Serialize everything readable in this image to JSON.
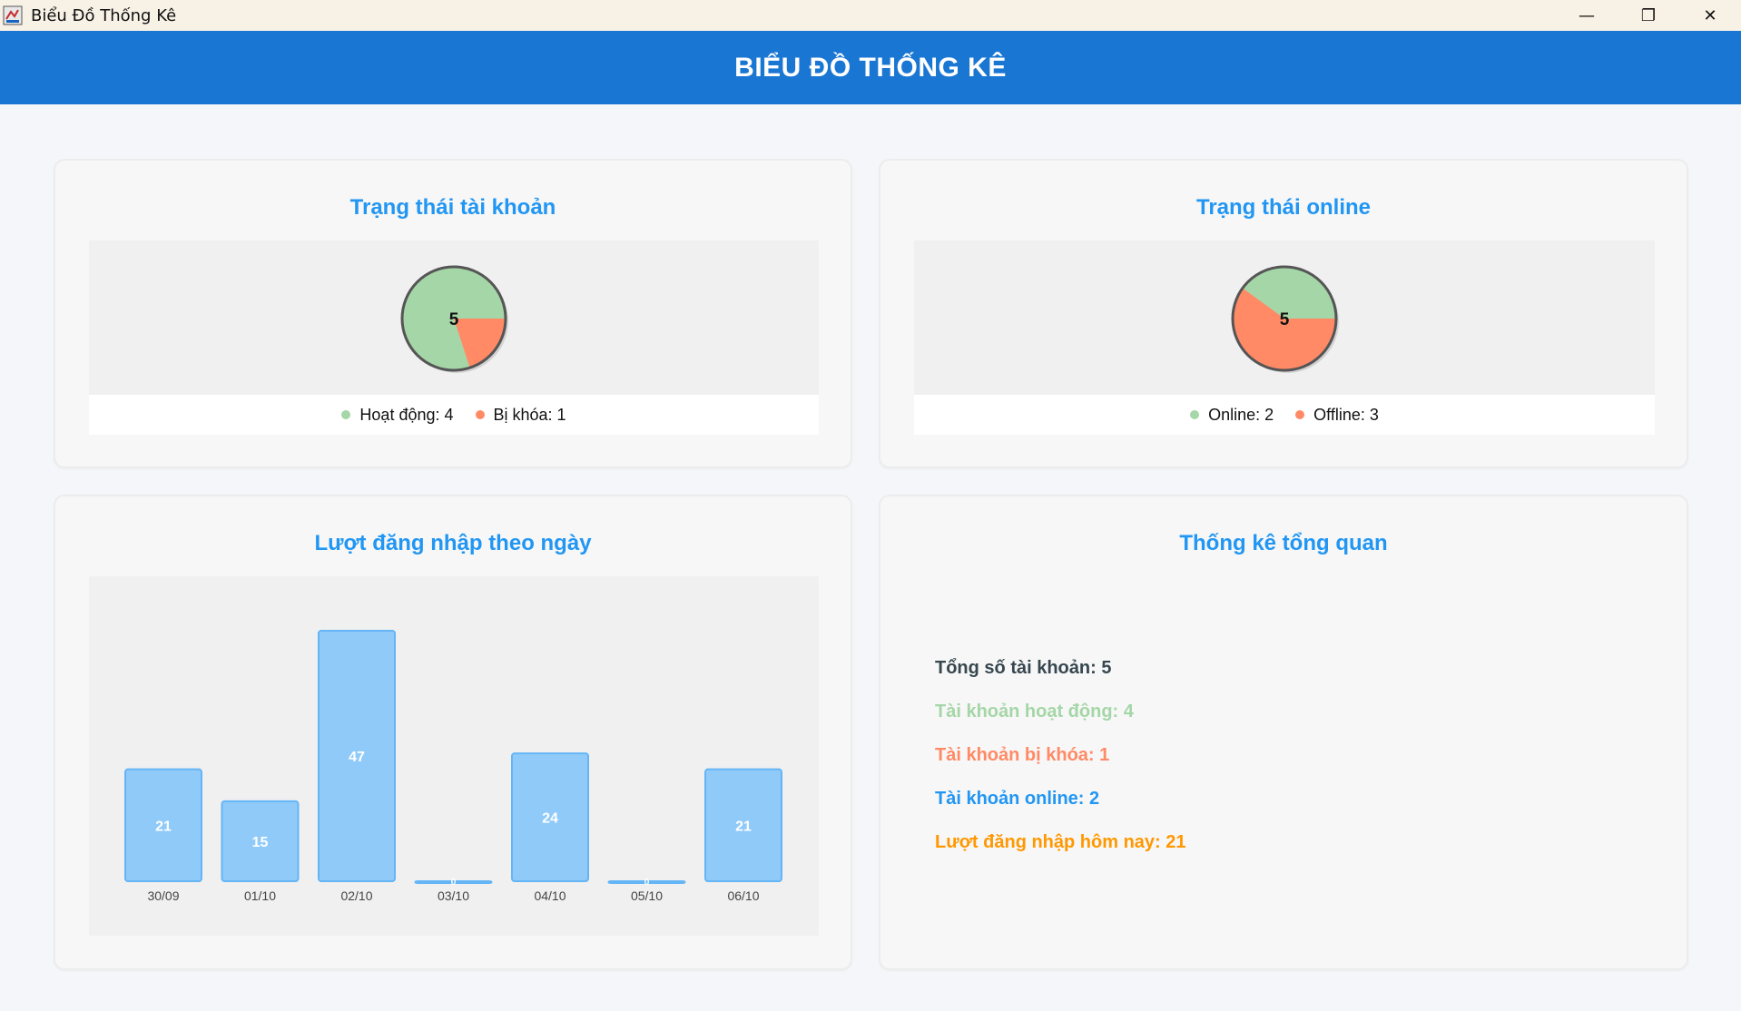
{
  "window": {
    "title": "Biểu Đồ Thống Kê",
    "controls": {
      "minimize": "—",
      "restore": "❐",
      "close": "✕"
    }
  },
  "header": {
    "title": "BIỂU ĐỒ THỐNG KÊ",
    "color": "#1976d2"
  },
  "colors": {
    "accent": "#2196f3",
    "green": "#a5d6a7",
    "orange": "#ff8a65",
    "bar": "#90caf9",
    "bar_border": "#64b5f6",
    "amber": "#ff9800",
    "dark": "#37474f"
  },
  "account_status": {
    "title": "Trạng thái tài khoản",
    "total_label": "5",
    "legend": [
      {
        "label": "Hoạt động: 4",
        "color": "#a5d6a7"
      },
      {
        "label": "Bị khóa: 1",
        "color": "#ff8a65"
      }
    ]
  },
  "online_status": {
    "title": "Trạng thái online",
    "total_label": "5",
    "legend": [
      {
        "label": "Online: 2",
        "color": "#a5d6a7"
      },
      {
        "label": "Offline: 3",
        "color": "#ff8a65"
      }
    ]
  },
  "logins": {
    "title": "Lượt đăng nhập theo ngày"
  },
  "overview": {
    "title": "Thống kê tổng quan",
    "lines": [
      {
        "text": "Tổng số tài khoản: 5",
        "color": "#37474f"
      },
      {
        "text": "Tài khoản hoạt động: 4",
        "color": "#a5d6a7"
      },
      {
        "text": "Tài khoản bị khóa: 1",
        "color": "#ff8a65"
      },
      {
        "text": "Tài khoản online: 2",
        "color": "#2196f3"
      },
      {
        "text": "Lượt đăng nhập hôm nay: 21",
        "color": "#ff9800"
      }
    ]
  },
  "chart_data": [
    {
      "type": "pie",
      "title": "Trạng thái tài khoản",
      "categories": [
        "Hoạt động",
        "Bị khóa"
      ],
      "values": [
        4,
        1
      ],
      "colors": [
        "#a5d6a7",
        "#ff8a65"
      ],
      "center_label": "5",
      "legend": "bottom"
    },
    {
      "type": "pie",
      "title": "Trạng thái online",
      "categories": [
        "Online",
        "Offline"
      ],
      "values": [
        2,
        3
      ],
      "colors": [
        "#a5d6a7",
        "#ff8a65"
      ],
      "center_label": "5",
      "legend": "bottom"
    },
    {
      "type": "bar",
      "title": "Lượt đăng nhập theo ngày",
      "categories": [
        "30/09",
        "01/10",
        "02/10",
        "03/10",
        "04/10",
        "05/10",
        "06/10"
      ],
      "values": [
        21,
        15,
        47,
        0,
        24,
        0,
        21
      ],
      "ylim": [
        0,
        47
      ],
      "grid": false
    }
  ]
}
